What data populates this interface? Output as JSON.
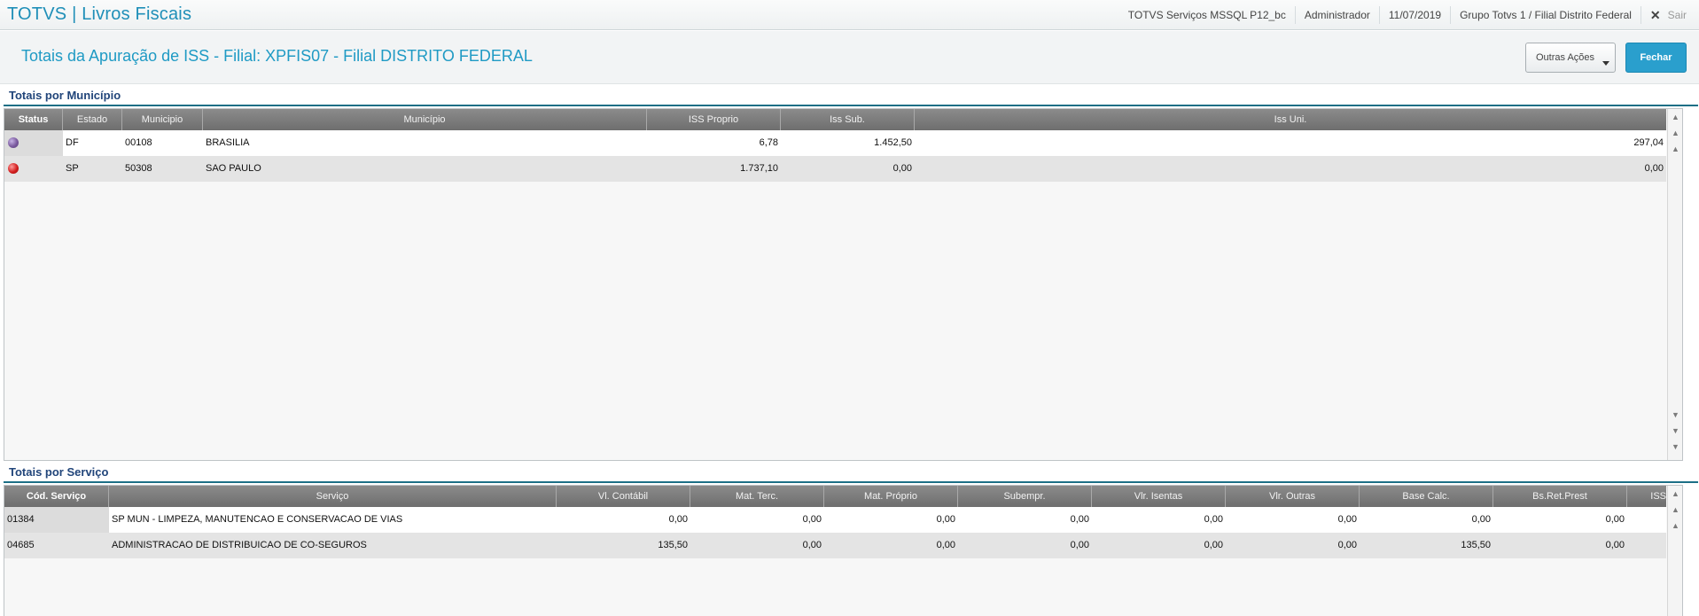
{
  "app": {
    "title": "TOTVS | Livros Fiscais"
  },
  "topbar": {
    "environment": "TOTVS Serviços MSSQL P12_bc",
    "user": "Administrador",
    "date": "11/07/2019",
    "company": "Grupo Totvs 1 / Filial Distrito Federal",
    "exit_label": "Sair"
  },
  "header": {
    "title": "Totais da Apuração de ISS - Filial: XPFIS07  - Filial DISTRITO FEDERAL",
    "more_actions": "Outras Ações",
    "close": "Fechar"
  },
  "municipio": {
    "title": "Totais por Município",
    "columns": [
      "Status",
      "Estado",
      "Municipio",
      "Município",
      "ISS Proprio",
      "Iss Sub.",
      "Iss Uni."
    ],
    "rows": [
      {
        "status": "purple",
        "estado": "DF",
        "codigo": "00108",
        "municipio": "BRASILIA",
        "iss_proprio": "6,78",
        "iss_sub": "1.452,50",
        "iss_uni": "297,04"
      },
      {
        "status": "red",
        "estado": "SP",
        "codigo": "50308",
        "municipio": "SAO PAULO",
        "iss_proprio": "1.737,10",
        "iss_sub": "0,00",
        "iss_uni": "0,00"
      }
    ]
  },
  "servico": {
    "title": "Totais por Serviço",
    "columns": [
      "Cód. Serviço",
      "Serviço",
      "Vl. Contábil",
      "Mat. Terc.",
      "Mat. Próprio",
      "Subempr.",
      "Vlr. Isentas",
      "Vlr. Outras",
      "Base Calc.",
      "Bs.Ret.Prest",
      "ISS"
    ],
    "rows": [
      {
        "codigo": "01384",
        "servico": "SP MUN - LIMPEZA, MANUTENCAO E CONSERVACAO DE VIAS",
        "vl_contabil": "0,00",
        "mat_terc": "0,00",
        "mat_proprio": "0,00",
        "subempr": "0,00",
        "isentas": "0,00",
        "outras": "0,00",
        "base_calc": "0,00",
        "bs_ret": "0,00"
      },
      {
        "codigo": "04685",
        "servico": "ADMINISTRACAO DE DISTRIBUICAO DE CO-SEGUROS",
        "vl_contabil": "135,50",
        "mat_terc": "0,00",
        "mat_proprio": "0,00",
        "subempr": "0,00",
        "isentas": "0,00",
        "outras": "0,00",
        "base_calc": "135,50",
        "bs_ret": "0,00"
      }
    ]
  }
}
